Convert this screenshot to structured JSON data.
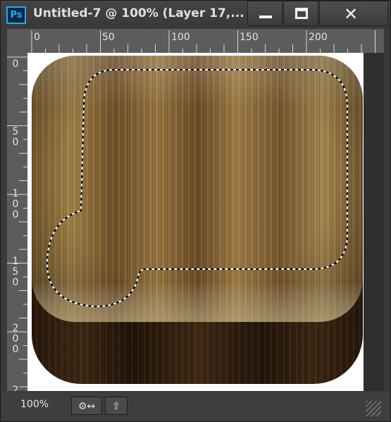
{
  "window": {
    "app_icon_text": "Ps",
    "title": "Untitled-7 @ 100% (Layer 17,..."
  },
  "buttons": {
    "minimize_icon": "minimize-icon",
    "maximize_icon": "maximize-icon",
    "close_icon": "close-icon",
    "close_glyph": "✕"
  },
  "ruler": {
    "horizontal": [
      "0",
      "50",
      "100",
      "150",
      "200"
    ],
    "vertical": [
      "0",
      "5\n0",
      "1\n0\n0",
      "1\n5\n0",
      "2\n0\n0",
      "2"
    ]
  },
  "status": {
    "zoom": "100%",
    "button1_glyph": "⚙↔",
    "button2_glyph": "⇪"
  },
  "colors": {
    "ps_blue": "#29a7f2",
    "wood_light": "#9b7a45",
    "wood_dark": "#2a1a0d",
    "window_chrome": "#3a3a3a"
  }
}
